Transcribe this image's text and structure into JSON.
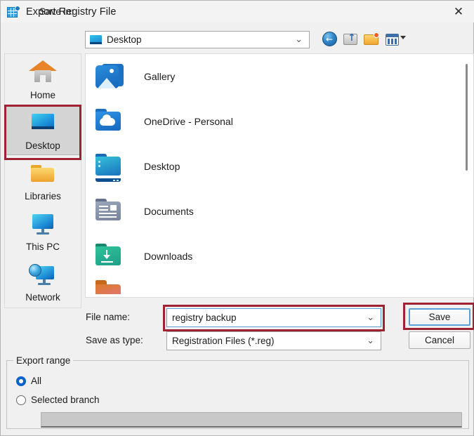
{
  "window": {
    "title": "Export Registry File",
    "icon": "registry-editor-icon",
    "close_label": "✕"
  },
  "savein": {
    "label": "Save in:",
    "value": "Desktop",
    "chevron": "⌄"
  },
  "toolbar": {
    "back_icon": "back-arrow-icon",
    "back_glyph": "←",
    "up_icon": "up-one-level-icon",
    "new_folder_icon": "new-folder-icon",
    "views_icon": "views-icon"
  },
  "places": {
    "items": [
      {
        "label": "Home",
        "icon": "home-icon",
        "selected": false
      },
      {
        "label": "Desktop",
        "icon": "desktop-monitor-icon",
        "selected": true
      },
      {
        "label": "Libraries",
        "icon": "libraries-folder-icon",
        "selected": false
      },
      {
        "label": "This PC",
        "icon": "this-pc-icon",
        "selected": false
      },
      {
        "label": "Network",
        "icon": "network-globe-icon",
        "selected": false
      }
    ]
  },
  "filelist": {
    "items": [
      {
        "label": "Gallery",
        "icon": "gallery-photos-icon"
      },
      {
        "label": "OneDrive - Personal",
        "icon": "onedrive-folder-icon"
      },
      {
        "label": "Desktop",
        "icon": "desktop-folder-icon"
      },
      {
        "label": "Documents",
        "icon": "documents-folder-icon"
      },
      {
        "label": "Downloads",
        "icon": "downloads-folder-icon"
      },
      {
        "label": "",
        "icon": "orange-folder-icon-partial"
      }
    ]
  },
  "form": {
    "filename_label": "File name:",
    "filename_value": "registry backup",
    "filename_placeholder": "File name",
    "savetype_label": "Save as type:",
    "savetype_value": "Registration Files (*.reg)",
    "chevron": "⌄",
    "save_label": "Save",
    "cancel_label": "Cancel"
  },
  "export_range": {
    "legend": "Export range",
    "options": [
      {
        "label": "All",
        "selected": true
      },
      {
        "label": "Selected branch",
        "selected": false
      }
    ],
    "branch_value": ""
  },
  "annotations": {
    "color": "#9e2231",
    "targets": [
      "desktop-place",
      "filename-combo",
      "save-button"
    ]
  }
}
